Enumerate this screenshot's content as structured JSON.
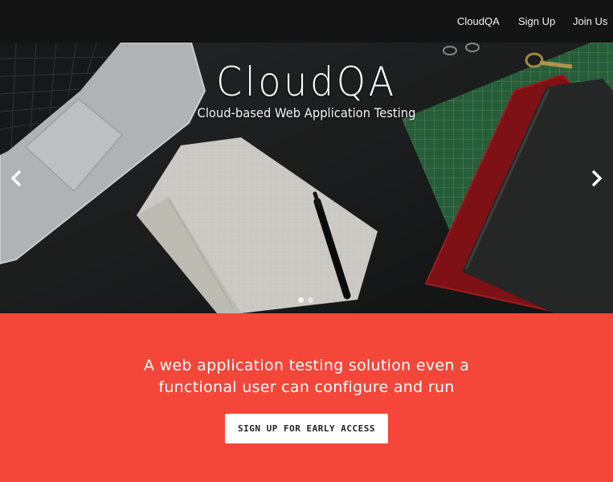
{
  "nav": {
    "items": [
      {
        "label": "CloudQA"
      },
      {
        "label": "Sign Up"
      },
      {
        "label": "Join Us"
      }
    ]
  },
  "hero": {
    "title": "CloudQA",
    "subtitle": "Cloud-based Web Application Testing",
    "prev_icon": "chevron-left-icon",
    "next_icon": "chevron-right-icon",
    "slide_count": 2,
    "active_slide": 1
  },
  "cta": {
    "tagline_line1": "A web application testing solution even a",
    "tagline_line2": "functional user can configure and run",
    "button_label": "SIGN UP FOR EARLY ACCESS"
  },
  "colors": {
    "nav_bg": "#141414",
    "cta_bg": "#f4473a",
    "button_bg": "#ffffff"
  }
}
